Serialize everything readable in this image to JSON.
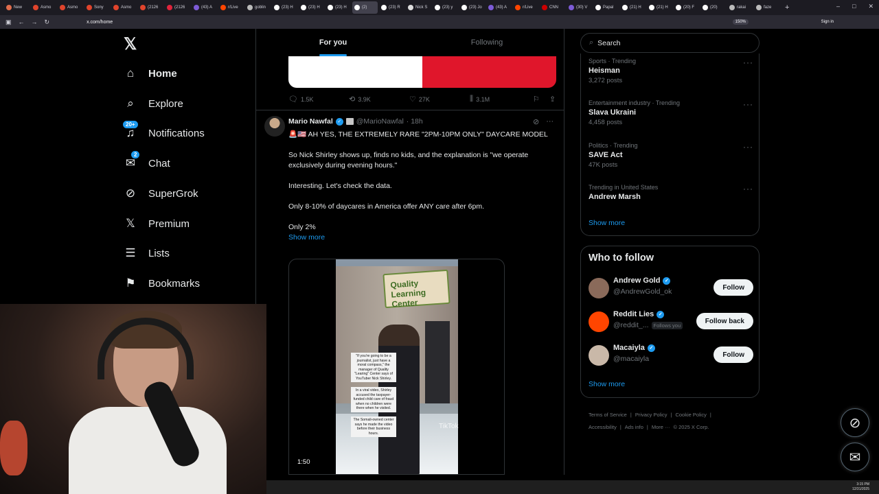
{
  "browser": {
    "tabs": [
      {
        "label": "New",
        "color": "#e06c4c"
      },
      {
        "label": "Asmo",
        "color": "#e0442c"
      },
      {
        "label": "Asmo",
        "color": "#e0442c"
      },
      {
        "label": "Sony",
        "color": "#e0442c"
      },
      {
        "label": "Asmo",
        "color": "#e0442c"
      },
      {
        "label": "(2126",
        "color": "#e0442c"
      },
      {
        "label": "(2126",
        "color": "#e0243c"
      },
      {
        "label": "(43) A",
        "color": "#7d5bd6"
      },
      {
        "label": "r/Live",
        "color": "#ff4500"
      },
      {
        "label": "goblin",
        "color": "#bbbbbb"
      },
      {
        "label": "(23) H",
        "color": "#ffffff"
      },
      {
        "label": "(23) H",
        "color": "#ffffff"
      },
      {
        "label": "(23) H",
        "color": "#ffffff"
      },
      {
        "label": "(2)",
        "color": "#ffffff"
      },
      {
        "label": "(23) R",
        "color": "#ffffff"
      },
      {
        "label": "Nick S",
        "color": "#dddddd"
      },
      {
        "label": "(23) y",
        "color": "#ffffff"
      },
      {
        "label": "(23) Jo",
        "color": "#ffffff"
      },
      {
        "label": "(43) A",
        "color": "#7d5bd6"
      },
      {
        "label": "r/Live",
        "color": "#ff4500"
      },
      {
        "label": "CNN",
        "color": "#cc0000"
      },
      {
        "label": "(30) V",
        "color": "#7d5bd6"
      },
      {
        "label": "Papal",
        "color": "#ffffff"
      },
      {
        "label": "(21) H",
        "color": "#ffffff"
      },
      {
        "label": "(21) H",
        "color": "#ffffff"
      },
      {
        "label": "(20) F",
        "color": "#ffffff"
      },
      {
        "label": "(20)",
        "color": "#ffffff"
      },
      {
        "label": "rakai",
        "color": "#bbbbbb"
      },
      {
        "label": "faze",
        "color": "#bbbbbb"
      }
    ],
    "url": "x.com/home",
    "zoom": "150%",
    "sign_in": "Sign in"
  },
  "nav": {
    "items": [
      {
        "icon": "home-icon",
        "glyph": "⌂",
        "label": "Home",
        "bold": true
      },
      {
        "icon": "search-icon",
        "glyph": "⌕",
        "label": "Explore"
      },
      {
        "icon": "bell-icon",
        "glyph": "♫",
        "label": "Notifications",
        "badge": "20+"
      },
      {
        "icon": "mail-icon",
        "glyph": "✉",
        "label": "Chat",
        "badge": "2"
      },
      {
        "icon": "grok-icon",
        "glyph": "⊘",
        "label": "SuperGrok"
      },
      {
        "icon": "x-premium-icon",
        "glyph": "𝕏",
        "label": "Premium"
      },
      {
        "icon": "list-icon",
        "glyph": "☰",
        "label": "Lists"
      },
      {
        "icon": "bookmark-icon",
        "glyph": "⚑",
        "label": "Bookmarks"
      }
    ]
  },
  "feed": {
    "tabs": [
      "For you",
      "Following"
    ],
    "prev_actions": {
      "replies": "1.5K",
      "reposts": "3.9K",
      "likes": "27K",
      "views": "3.1M"
    },
    "tweet": {
      "name": "Mario Nawfal",
      "handle": "@MarioNawfal",
      "time": "· 18h",
      "paragraphs": [
        "🚨🇺🇸 AH YES, THE EXTREMELY RARE \"2PM-10PM ONLY\" DAYCARE MODEL",
        "So Nick Shirley shows up, finds no kids, and the explanation is \"we operate exclusively during evening hours.\"",
        "Interesting. Let's check the data.",
        "Only 8-10% of daycares in America offer ANY care after 6pm."
      ],
      "last_line": "Only 2%",
      "show_more": "Show more",
      "video": {
        "sign": "Quality Learning Center",
        "captions": [
          "\"If you're going to be a journalist, just have a moral compass,\" the manager of Quality \"Learing\" Center says of YouTuber Nick Shirley.",
          "In a viral video, Shirley accused the taxpayer-funded child care of fraud when no children were there when he visited.",
          "The Somali-owned center says he made the video before their business hours."
        ],
        "watermark": "TikTok",
        "duration": "1:50"
      }
    }
  },
  "sidebar": {
    "search_placeholder": "Search",
    "trends": [
      {
        "category": "Sports · Trending",
        "name": "Heisman",
        "count": "3,272 posts"
      },
      {
        "category": "Entertainment industry · Trending",
        "name": "Slava Ukraini",
        "count": "4,458 posts"
      },
      {
        "category": "Politics · Trending",
        "name": "SAVE Act",
        "count": "47K posts"
      },
      {
        "category": "Trending in United States",
        "name": "Andrew Marsh",
        "count": ""
      }
    ],
    "trends_show_more": "Show more",
    "who_to_follow": {
      "title": "Who to follow",
      "accounts": [
        {
          "name": "Andrew Gold",
          "handle": "@AndrewGold_ok",
          "button": "Follow",
          "follows_you": "",
          "avatar_color": "#8a6a5a"
        },
        {
          "name": "Reddit Lies",
          "handle": "@reddit_...",
          "button": "Follow back",
          "follows_you": "Follows you",
          "avatar_color": "#ff4500"
        },
        {
          "name": "Macaiyla",
          "handle": "@macaiyla",
          "button": "Follow",
          "follows_you": "",
          "avatar_color": "#c9b8a8"
        }
      ],
      "show_more": "Show more"
    },
    "footer": {
      "line1": [
        "Terms of Service",
        "|",
        "Privacy Policy",
        "|",
        "Cookie Policy",
        "|"
      ],
      "line2": [
        "Accessibility",
        "|",
        "Ads info",
        "|",
        "More ···",
        "© 2025 X Corp."
      ]
    }
  },
  "taskbar": {
    "time": "3:15 PM",
    "date": "12/31/2025"
  }
}
